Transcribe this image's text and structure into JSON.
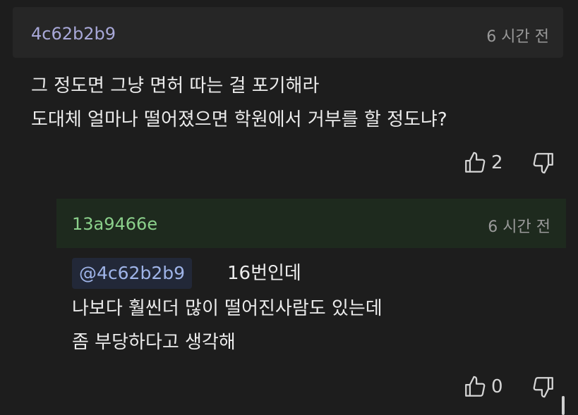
{
  "comment": {
    "author": "4c62b2b9",
    "time": "6 시간 전",
    "lines": [
      "그 정도면 그냥 면허 따는 걸 포기해라",
      "도대체 얼마나 떨어졌으면 학원에서 거부를 할 정도냐?"
    ],
    "likes": "2"
  },
  "reply": {
    "author": "13a9466e",
    "time": "6 시간 전",
    "mention": "@4c62b2b9",
    "first_line": "16번인데",
    "lines": [
      "나보다 훨씬더 많이 떨어진사람도 있는데",
      "좀 부당하다고 생각해"
    ],
    "likes": "0"
  },
  "icons": [
    "thumbs-up-icon",
    "thumbs-down-icon"
  ]
}
